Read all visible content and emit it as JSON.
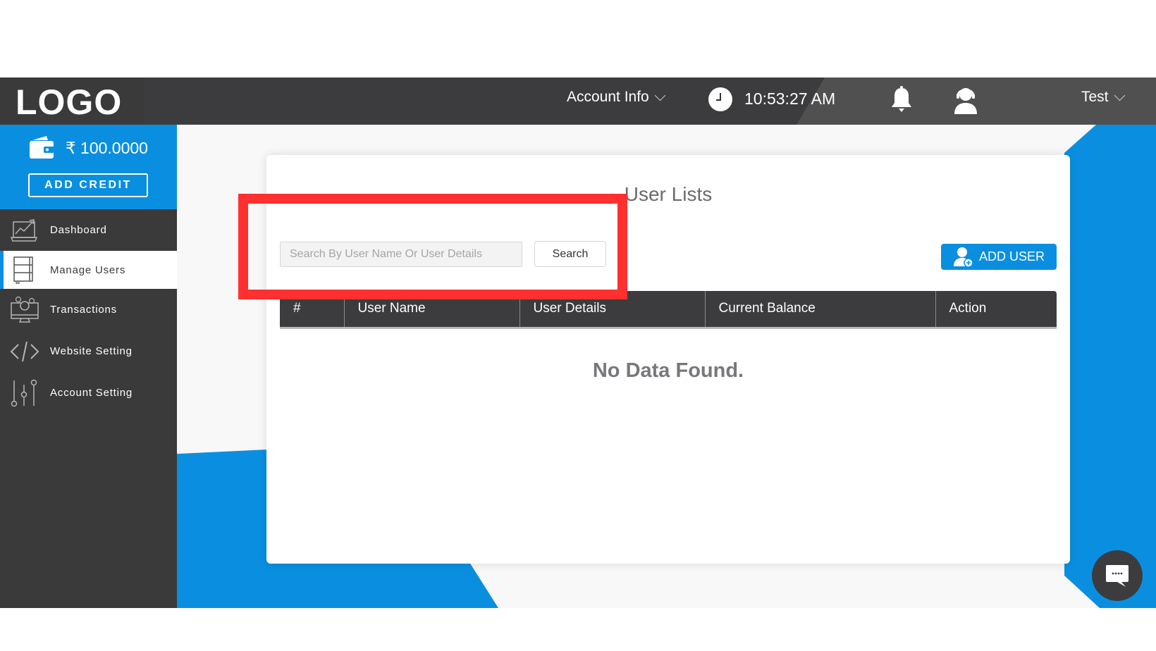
{
  "header": {
    "logo": "LOGO",
    "account_info_label": "Account Info",
    "time": "10:53:27 AM",
    "user_menu_label": "Test",
    "icons": [
      "clock-icon",
      "bell-icon",
      "support-agent-icon",
      "chevron-down-icon"
    ]
  },
  "sidebar": {
    "balance": "₹ 100.0000",
    "add_credit_label": "ADD CREDIT",
    "items": [
      {
        "label": "Dashboard",
        "icon": "laptop-chart-icon",
        "active": false
      },
      {
        "label": "Manage Users",
        "icon": "notebook-icon",
        "active": true
      },
      {
        "label": "Transactions",
        "icon": "monitor-coins-icon",
        "active": false
      },
      {
        "label": "Website Setting",
        "icon": "code-icon",
        "active": false
      },
      {
        "label": "Account Setting",
        "icon": "sliders-icon",
        "active": false
      }
    ]
  },
  "main": {
    "title": "User Lists",
    "search": {
      "placeholder": "Search By User Name Or User Details",
      "value": "",
      "button_label": "Search"
    },
    "add_user_label": "ADD USER",
    "table": {
      "columns": [
        "#",
        "User Name",
        "User Details",
        "Current Balance",
        "Action"
      ],
      "rows": []
    },
    "empty_message": "No Data Found."
  },
  "colors": {
    "accent": "#0a8fe0",
    "header_bg": "#3c3c3e",
    "highlight": "#fe3030"
  }
}
